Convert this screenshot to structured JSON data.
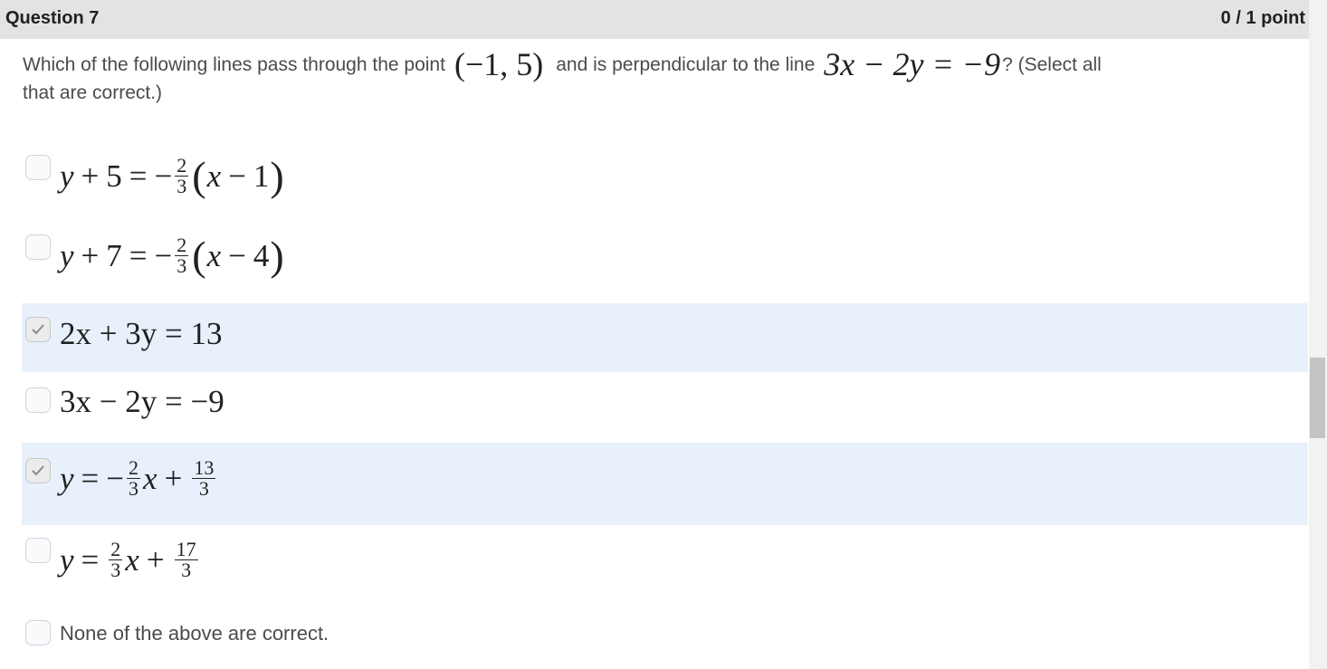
{
  "question": {
    "title": "Question 7",
    "points": "0 / 1 point",
    "prompt_before": "Which of the following lines pass through the point",
    "point_math": "(−1,  5)",
    "prompt_mid": "and is perpendicular to the line",
    "line_math": "3x − 2y = −9",
    "prompt_after": "?   (Select all",
    "prompt_line2": "that are correct.)"
  },
  "options": [
    {
      "equation": "y + 5 = −2/3(x − 1)",
      "checked": false
    },
    {
      "equation": "y + 7 = −2/3(x − 4)",
      "checked": false
    },
    {
      "equation": "2x + 3y = 13",
      "checked": true
    },
    {
      "equation": "3x − 2y = −9",
      "checked": false
    },
    {
      "equation": "y = −2/3 x + 13/3",
      "checked": true
    },
    {
      "equation": "y = 2/3 x + 17/3",
      "checked": false
    },
    {
      "label": "None of the above are correct.",
      "checked": false
    }
  ],
  "icons": {
    "checkbox_checked": "check-icon"
  },
  "colors": {
    "header_bg": "#e3e3e3",
    "selected_row_bg": "#e8f1fb",
    "text": "#494c4e"
  },
  "fragments": {
    "o1a": "y",
    "o1b": "5",
    "o1c": "2",
    "o1d": "3",
    "o1e": "x",
    "o1f": "1",
    "o2a": "y",
    "o2b": "7",
    "o2c": "2",
    "o2d": "3",
    "o2e": "x",
    "o2f": "4",
    "o3": "2x + 3y = 13",
    "o4": "3x − 2y = −9",
    "o5a": "y",
    "o5c": "2",
    "o5d": "3",
    "o5e": "x",
    "o5g": "13",
    "o5h": "3",
    "o6a": "y",
    "o6c": "2",
    "o6d": "3",
    "o6e": "x",
    "o6g": "17",
    "o6h": "3"
  }
}
